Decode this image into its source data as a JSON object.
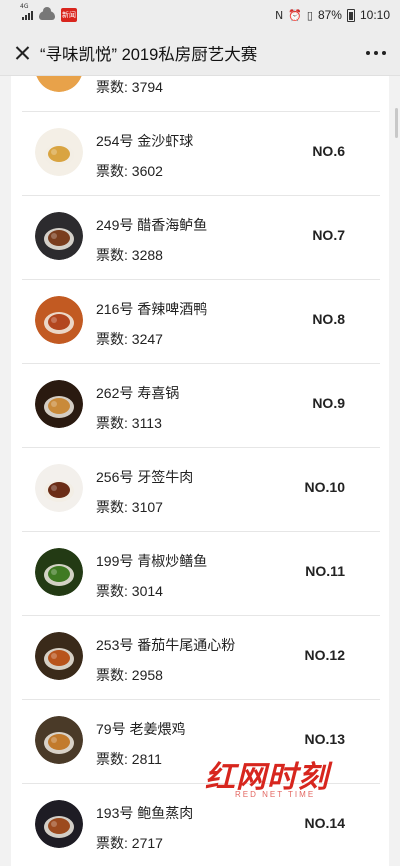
{
  "status_bar": {
    "network": "4G",
    "app_badge": "新闻",
    "nfc": "N",
    "battery": "87%",
    "time": "10:10"
  },
  "nav": {
    "title": "“寻味凯悦” 2019私房厨艺大赛"
  },
  "partial_row": {
    "votes": "票数: 3794"
  },
  "entries": [
    {
      "name": "254号 金沙虾球",
      "votes": "票数: 3602",
      "rank": "NO.6",
      "thumb_color": "#d9a441",
      "plate_color": "#f4efe6"
    },
    {
      "name": "249号 醋香海鲈鱼",
      "votes": "票数: 3288",
      "rank": "NO.7",
      "thumb_color": "#7a3d1e",
      "plate_color": "#2c2b2e"
    },
    {
      "name": "216号 香辣啤酒鸭",
      "votes": "票数: 3247",
      "rank": "NO.8",
      "thumb_color": "#b3461f",
      "plate_color": "#c25a22"
    },
    {
      "name": "262号 寿喜锅",
      "votes": "票数: 3113",
      "rank": "NO.9",
      "thumb_color": "#c98a3a",
      "plate_color": "#2a1a10"
    },
    {
      "name": "256号 牙签牛肉",
      "votes": "票数: 3107",
      "rank": "NO.10",
      "thumb_color": "#6b2d16",
      "plate_color": "#f3f0ec"
    },
    {
      "name": "199号 青椒炒鳝鱼",
      "votes": "票数: 3014",
      "rank": "NO.11",
      "thumb_color": "#3f7a22",
      "plate_color": "#233a14"
    },
    {
      "name": "253号 番茄牛尾通心粉",
      "votes": "票数: 2958",
      "rank": "NO.12",
      "thumb_color": "#b8541c",
      "plate_color": "#3a2a1a"
    },
    {
      "name": "79号 老姜煨鸡",
      "votes": "票数: 2811",
      "rank": "NO.13",
      "thumb_color": "#c27a2c",
      "plate_color": "#4a3a28"
    },
    {
      "name": "193号 鲍鱼蒸肉",
      "votes": "票数: 2717",
      "rank": "NO.14",
      "thumb_color": "#9c4a1e",
      "plate_color": "#1e1c24"
    }
  ],
  "watermark": {
    "text": "红网时刻",
    "sub": "RED NET TIME"
  },
  "colors": {
    "accent": "#d7261e",
    "bar_bg": "#ededed"
  }
}
